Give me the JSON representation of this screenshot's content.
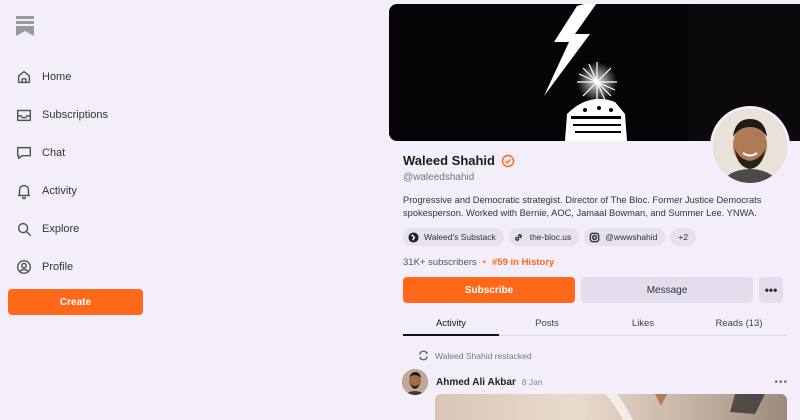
{
  "sidebar": {
    "items": [
      {
        "label": "Home",
        "icon": "home-icon"
      },
      {
        "label": "Subscriptions",
        "icon": "inbox-icon"
      },
      {
        "label": "Chat",
        "icon": "chat-icon"
      },
      {
        "label": "Activity",
        "icon": "bell-icon"
      },
      {
        "label": "Explore",
        "icon": "search-icon"
      },
      {
        "label": "Profile",
        "icon": "user-icon"
      }
    ],
    "create_label": "Create"
  },
  "profile": {
    "name": "Waleed Shahid",
    "handle": "@waleedshahid",
    "bio": "Progressive and Democratic strategist. Director of The Bloc. Former Justice Democrats spokesperson. Worked with Bernie, AOC, Jamaal Bowman, and Summer Lee. YNWA.",
    "links": [
      {
        "label": "Waleed's Substack",
        "icon": "publication-avatar-icon"
      },
      {
        "label": "the-bloc.us",
        "icon": "link-icon"
      },
      {
        "label": "@wwwshahid",
        "icon": "instagram-icon"
      }
    ],
    "more_links": "+2",
    "subscribers": "31K+ subscribers",
    "rank": "#59 in History"
  },
  "actions": {
    "subscribe": "Subscribe",
    "message": "Message",
    "more": "•••"
  },
  "tabs": [
    "Activity",
    "Posts",
    "Likes",
    "Reads (13)"
  ],
  "feed": {
    "restack_text": "Waleed Shahid restacked",
    "post_author": "Ahmed Ali Akbar",
    "post_date": "8 Jan",
    "post_more": "•••"
  },
  "colors": {
    "accent": "#ff6719",
    "background": "#f3eefa",
    "chip": "#e7e1ef"
  }
}
